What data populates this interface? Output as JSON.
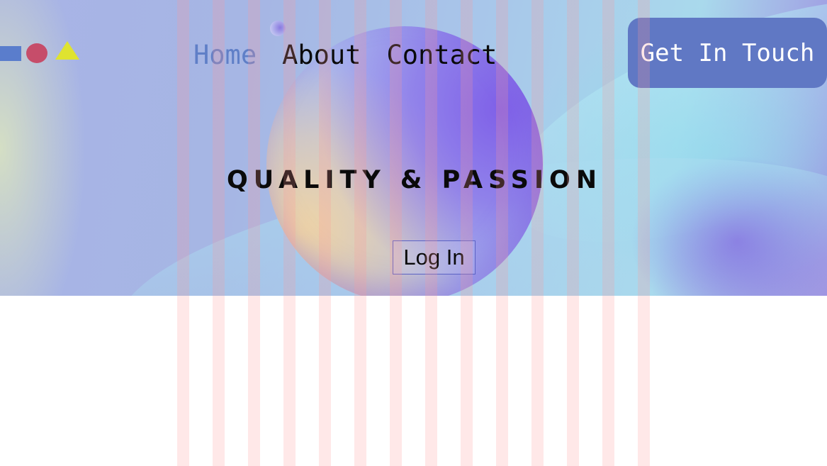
{
  "logo": {
    "shapes": [
      "square",
      "circle",
      "triangle"
    ],
    "colors": {
      "square": "#5a7dcc",
      "circle": "#c64d6a",
      "triangle": "#dfe330"
    }
  },
  "nav": {
    "items": [
      {
        "label": "Home",
        "active": true
      },
      {
        "label": "About",
        "active": false
      },
      {
        "label": "Contact",
        "active": false
      }
    ],
    "active_color": "#5f7fc7"
  },
  "cta": {
    "label": "Get In Touch",
    "color": "#6078c4"
  },
  "hero": {
    "headline": "QUALITY & PASSION",
    "login_label": "Log In"
  },
  "colors": {
    "accent": "#6078c4",
    "login_border": "#5b62c4",
    "text": "#0a0a0a"
  }
}
